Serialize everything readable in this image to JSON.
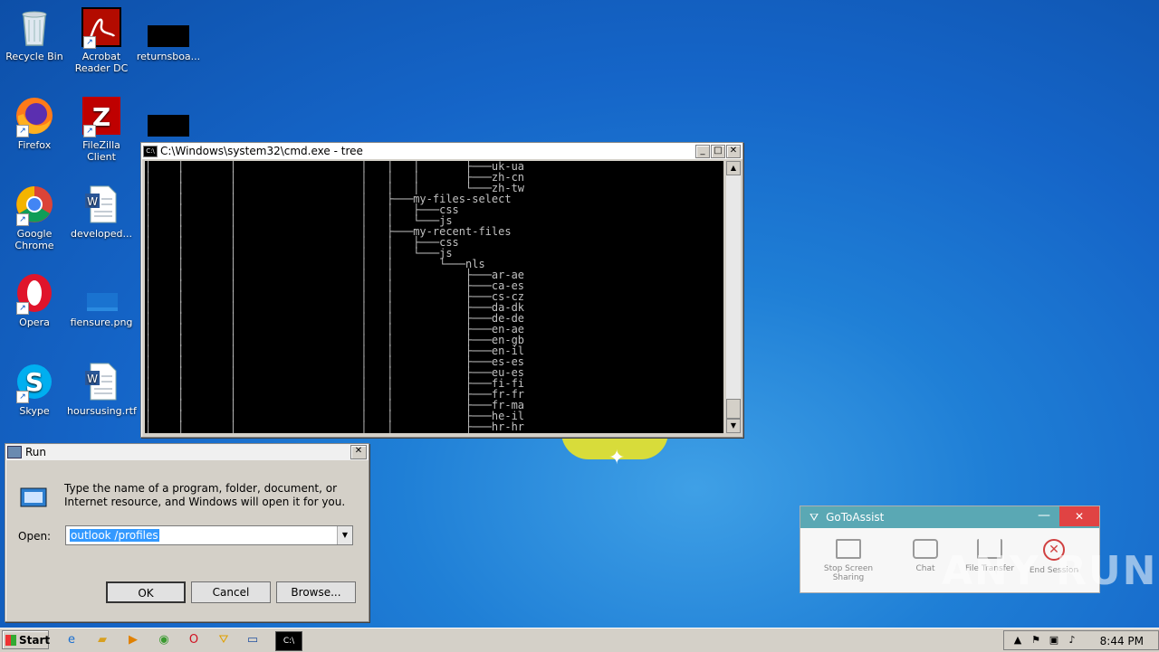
{
  "desktop": {
    "icons": [
      {
        "label": "Recycle Bin"
      },
      {
        "label": "Acrobat Reader DC"
      },
      {
        "label": "returnsboa..."
      },
      {
        "label": "Firefox"
      },
      {
        "label": "FileZilla Client"
      },
      {
        "label": "Google Chrome"
      },
      {
        "label": "developed..."
      },
      {
        "label": "Opera"
      },
      {
        "label": "fiensure.png"
      },
      {
        "label": "Skype"
      },
      {
        "label": "hoursusing.rtf"
      }
    ]
  },
  "cmd": {
    "title": "C:\\Windows\\system32\\cmd.exe - tree",
    "tree_text": "│    │       │                   │   │   │       ├───uk-ua\n│    │       │                   │   │   │       ├───zh-cn\n│    │       │                   │   │   │       └───zh-tw\n│    │       │                   │   ├───my-files-select\n│    │       │                   │   │   ├───css\n│    │       │                   │   │   └───js\n│    │       │                   │   ├───my-recent-files\n│    │       │                   │   │   ├───css\n│    │       │                   │   │   └───js\n│    │       │                   │   │       └───nls\n│    │       │                   │   │           ├───ar-ae\n│    │       │                   │   │           ├───ca-es\n│    │       │                   │   │           ├───cs-cz\n│    │       │                   │   │           ├───da-dk\n│    │       │                   │   │           ├───de-de\n│    │       │                   │   │           ├───en-ae\n│    │       │                   │   │           ├───en-gb\n│    │       │                   │   │           ├───en-il\n│    │       │                   │   │           ├───es-es\n│    │       │                   │   │           ├───eu-es\n│    │       │                   │   │           ├───fi-fi\n│    │       │                   │   │           ├───fr-fr\n│    │       │                   │   │           ├───fr-ma\n│    │       │                   │   │           ├───he-il\n│    │       │                   │   │           ├───hr-hr"
  },
  "run": {
    "title": "Run",
    "description": "Type the name of a program, folder, document, or Internet resource, and Windows will open it for you.",
    "open_label": "Open:",
    "open_value": "outlook /profiles",
    "ok": "OK",
    "cancel": "Cancel",
    "browse": "Browse..."
  },
  "gotoassist": {
    "title": "GoToAssist",
    "items": [
      "Stop Screen Sharing",
      "Chat",
      "File Transfer",
      "End Session"
    ]
  },
  "watermark": "ANY RUN",
  "taskbar": {
    "start": "Start",
    "clock": "8:44 PM"
  },
  "colors": {
    "desktop_blue": "#1f7fd6",
    "gotoassist_teal": "#5aa8b4",
    "close_red": "#e04343",
    "selection_blue": "#3399ff"
  }
}
